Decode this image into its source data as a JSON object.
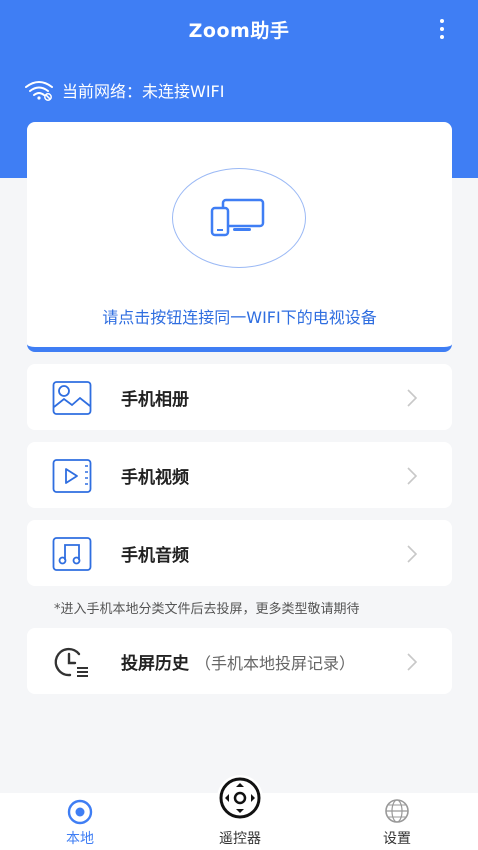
{
  "header": {
    "title": "Zoom助手"
  },
  "network": {
    "label": "当前网络：",
    "status": "未连接WIFI"
  },
  "connect_card": {
    "instruction": "请点击按钮连接同一WIFI下的电视设备"
  },
  "menu": [
    {
      "label": "手机相册",
      "icon": "photo-icon"
    },
    {
      "label": "手机视频",
      "icon": "video-icon"
    },
    {
      "label": "手机音频",
      "icon": "music-icon"
    }
  ],
  "note": "*进入手机本地分类文件后去投屏，更多类型敬请期待",
  "history": {
    "label": "投屏历史",
    "sub": "（手机本地投屏记录）"
  },
  "tabs": {
    "home": "本地",
    "remote": "遥控器",
    "settings": "设置"
  },
  "colors": {
    "primary": "#3f7ef4",
    "background": "#f5f6f8"
  }
}
